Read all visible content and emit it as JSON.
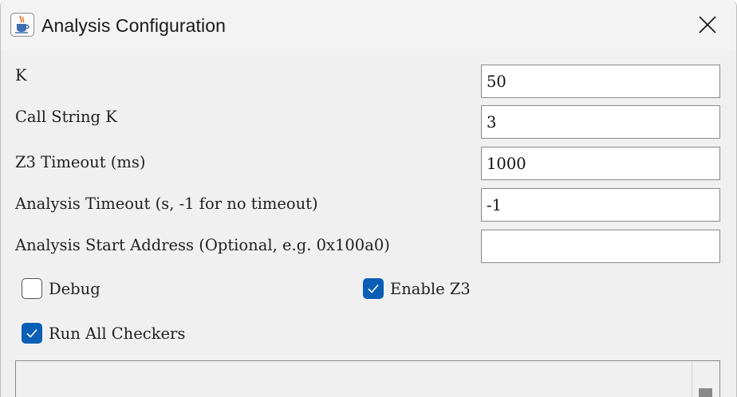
{
  "window": {
    "title": "Analysis Configuration",
    "app_icon": "java-cup-icon",
    "close_icon": "close-icon"
  },
  "fields": [
    {
      "label": "K",
      "value": "50"
    },
    {
      "label": "Call String K",
      "value": "3"
    },
    {
      "label": "Z3 Timeout (ms)",
      "value": "1000"
    },
    {
      "label": "Analysis Timeout (s, -1 for no timeout)",
      "value": "-1"
    },
    {
      "label": "Analysis Start Address (Optional, e.g. 0x100a0)",
      "value": ""
    }
  ],
  "checkboxes": {
    "debug": {
      "label": "Debug",
      "checked": false
    },
    "enable_z3": {
      "label": "Enable Z3",
      "checked": true
    },
    "run_all_checkers": {
      "label": "Run All Checkers",
      "checked": true
    }
  },
  "colors": {
    "checkbox_checked": "#0a5fb5",
    "window_bg": "#f0f0f0"
  }
}
